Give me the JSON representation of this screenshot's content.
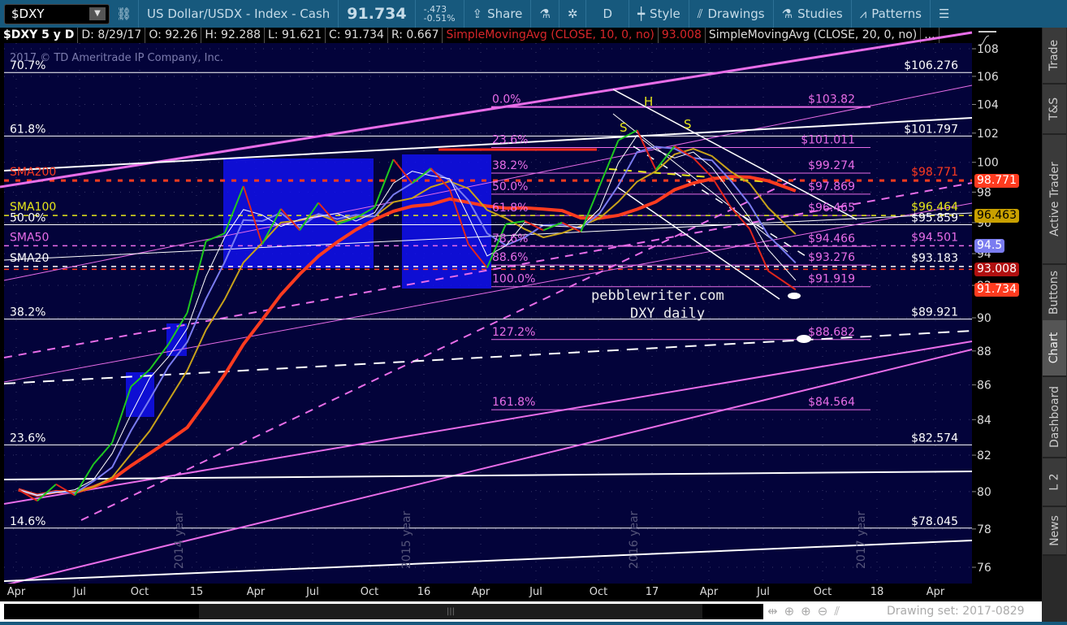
{
  "toolbar": {
    "symbol": "$DXY",
    "description": "US Dollar/USDX - Index - Cash",
    "last": "91.734",
    "change": "-.473",
    "change_pct": "-0.51%",
    "share": "Share",
    "aggregation": "D",
    "style": "Style",
    "drawings": "Drawings",
    "studies": "Studies",
    "patterns": "Patterns"
  },
  "infobar": {
    "title": "$DXY 5 y D",
    "date": "D: 8/29/17",
    "open": "O: 92.26",
    "high": "H: 92.288",
    "low": "L: 91.621",
    "close": "C: 91.734",
    "range": "R: 0.667",
    "study1": "SimpleMovingAvg (CLOSE, 10, 0, no)",
    "study1_value": "93.008",
    "study2": "SimpleMovingAvg (CLOSE, 20, 0, no)",
    "more": "..."
  },
  "side_tabs": [
    "Trade",
    "T&S",
    "Active Trader",
    "Buttons",
    "Chart",
    "Dashboard",
    "L 2",
    "News"
  ],
  "active_tab": "Chart",
  "scrollbar": {
    "drawing_set": "Drawing set: 2017-0829"
  },
  "colors": {
    "background": "#03033a",
    "price_up": "#1fc81f",
    "price_down": "#e0261c",
    "sma200": "#ff3b1f",
    "sma100": "#c8a21a",
    "sma50": "#7a7cf0",
    "sma20": "#ffffff",
    "fib_pink": "#e86de8"
  },
  "chart_data": {
    "type": "line",
    "copyright": "2017 © TD Ameritrade IP Company, Inc.",
    "y_scale": "log",
    "ylim": [
      75,
      109
    ],
    "y_ticks": [
      108,
      106,
      104,
      102,
      100,
      98,
      96,
      94,
      92,
      90,
      88,
      86,
      84,
      82,
      80,
      78,
      76
    ],
    "x_ticks": [
      "Apr",
      "Jul",
      "Oct",
      "15",
      "Apr",
      "Jul",
      "Oct",
      "16",
      "Apr",
      "Jul",
      "Oct",
      "17",
      "Apr",
      "Jul",
      "Oct",
      "18",
      "Apr"
    ],
    "year_labels": [
      "2014 year",
      "2015 year",
      "2016 year",
      "2017 year"
    ],
    "grid": true,
    "series": [
      {
        "name": "$DXY",
        "x": [
          "2014-03",
          "2014-04",
          "2014-05",
          "2014-06",
          "2014-07",
          "2014-08",
          "2014-09",
          "2014-10",
          "2014-11",
          "2014-12",
          "2015-01",
          "2015-02",
          "2015-03",
          "2015-04",
          "2015-05",
          "2015-06",
          "2015-07",
          "2015-08",
          "2015-09",
          "2015-10",
          "2015-11",
          "2015-12",
          "2016-01",
          "2016-02",
          "2016-03",
          "2016-04",
          "2016-05",
          "2016-06",
          "2016-07",
          "2016-08",
          "2016-09",
          "2016-10",
          "2016-11",
          "2016-12",
          "2017-01",
          "2017-02",
          "2017-03",
          "2017-04",
          "2017-05",
          "2017-06",
          "2017-07",
          "2017-08-29"
        ],
        "values": [
          80.1,
          79.5,
          80.4,
          79.8,
          81.5,
          82.7,
          85.9,
          86.9,
          88.4,
          90.3,
          94.8,
          95.3,
          98.4,
          94.6,
          96.9,
          95.5,
          97.3,
          95.9,
          96.3,
          97.0,
          100.2,
          98.6,
          99.6,
          98.2,
          94.6,
          93.1,
          95.9,
          96.1,
          95.5,
          96.0,
          95.4,
          98.4,
          101.5,
          102.2,
          99.5,
          101.1,
          100.3,
          99.0,
          97.0,
          95.6,
          92.9,
          91.734
        ]
      }
    ],
    "moving_averages": [
      {
        "name": "SMA200",
        "value": 98.771,
        "color": "#ff3b1f"
      },
      {
        "name": "SMA100",
        "value": 96.464,
        "color": "#e8e81a"
      },
      {
        "name": "SMA50",
        "value": 94.501,
        "color": "#e86de8"
      },
      {
        "name": "SMA20",
        "value": 93.183,
        "color": "#ffffff"
      }
    ],
    "price_badges": [
      {
        "value": "98.771",
        "color": "#ff3b1f"
      },
      {
        "value": "96.463",
        "color": "#c8a000"
      },
      {
        "value": "94.5",
        "color": "#7a7cf0"
      },
      {
        "value": "93.008",
        "color": "#b01010"
      },
      {
        "value": "91.734",
        "color": "#ff3b1f"
      }
    ],
    "fib_long": [
      {
        "pct": "70.7%",
        "value": 106.276,
        "label": "$106.276"
      },
      {
        "pct": "61.8%",
        "value": 101.797,
        "label": "$101.797"
      },
      {
        "pct": "50.0%",
        "value": 95.859,
        "label": "$95.859"
      },
      {
        "pct": "38.2%",
        "value": 89.921,
        "label": "$89.921"
      },
      {
        "pct": "23.6%",
        "value": 82.574,
        "label": "$82.574"
      },
      {
        "pct": "14.6%",
        "value": 78.045,
        "label": "$78.045"
      }
    ],
    "fib_short": [
      {
        "pct": "0.0%",
        "value": 103.82,
        "label": "$103.82"
      },
      {
        "pct": "23.6%",
        "value": 101.011,
        "label": "$101.011"
      },
      {
        "pct": "38.2%",
        "value": 99.274,
        "label": "$99.274"
      },
      {
        "pct": "50.0%",
        "value": 97.869,
        "label": "$97.869"
      },
      {
        "pct": "61.8%",
        "value": 96.465,
        "label": "$96.465"
      },
      {
        "pct": "78.6%",
        "value": 94.466,
        "label": "$94.466"
      },
      {
        "pct": "88.6%",
        "value": 93.276,
        "label": "$93.276"
      },
      {
        "pct": "100.0%",
        "value": 91.919,
        "label": "$91.919"
      },
      {
        "pct": "127.2%",
        "value": 88.682,
        "label": "$88.682"
      },
      {
        "pct": "161.8%",
        "value": 84.564,
        "label": "$84.564"
      }
    ],
    "ma_labels": [
      {
        "text": "SMA200",
        "value": 98.771,
        "price_label": "$98.771",
        "color": "#ff3b1f"
      },
      {
        "text": "SMA100",
        "value": 96.464,
        "price_label": "$96.464",
        "color": "#e8e81a"
      },
      {
        "text": "SMA50",
        "value": 94.501,
        "price_label": "$94.501",
        "color": "#e86de8"
      },
      {
        "text": "SMA20",
        "value": 93.183,
        "price_label": "$93.183",
        "color": "#ffffff"
      }
    ],
    "pattern_labels": [
      "S",
      "H",
      "S"
    ],
    "annotations": [
      "pebblewriter.com",
      "DXY daily"
    ]
  }
}
